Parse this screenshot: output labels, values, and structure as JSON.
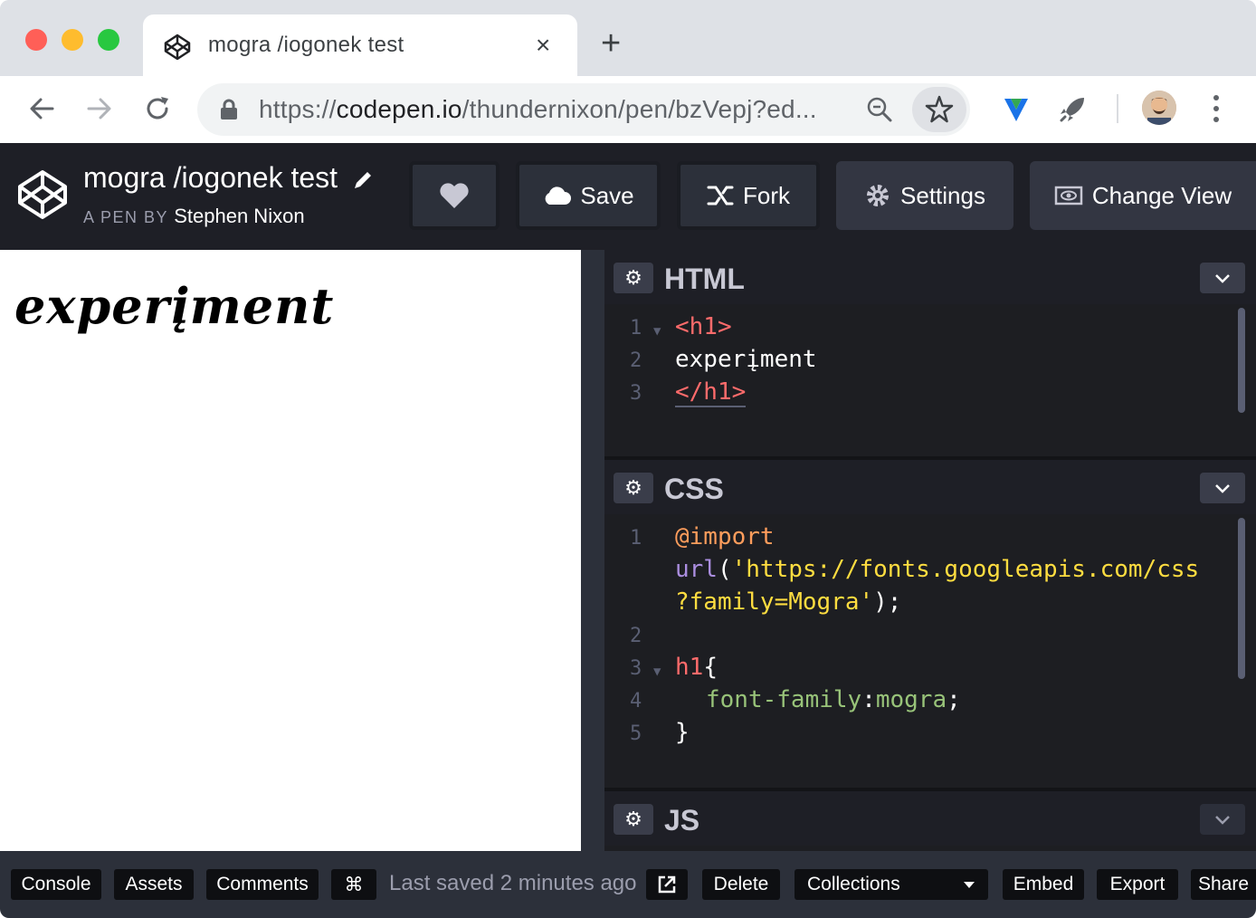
{
  "browser": {
    "tab_title": "mogra /iogonek test",
    "tab_close_icon": "×",
    "new_tab_icon": "+",
    "url_scheme": "https://",
    "url_host": "codepen.io",
    "url_path": "/thundernixon/pen/bzVepj?ed..."
  },
  "header": {
    "pen_title": "mogra /iogonek test",
    "by_label": "A PEN BY",
    "author": "Stephen Nixon",
    "buttons": {
      "save": "Save",
      "fork": "Fork",
      "settings": "Settings",
      "change_view": "Change View"
    }
  },
  "result": {
    "heading": "experįment"
  },
  "editors": {
    "html": {
      "name": "HTML",
      "lines": [
        {
          "n": "1",
          "text": "<h1>"
        },
        {
          "n": "2",
          "text": "experįment"
        },
        {
          "n": "3",
          "text": "</h1>"
        }
      ]
    },
    "css": {
      "name": "CSS",
      "line_numbers": [
        "1",
        "2",
        "3",
        "4",
        "5"
      ],
      "import": "@import",
      "url_fn": "url",
      "url_open": "(",
      "url_str_1": "'https://fonts.googleapis.com/css",
      "url_str_2": "?family=Mogra'",
      "url_close": ");",
      "selector": "h1",
      "brace_open": "{",
      "property": "font-family",
      "colon": ":",
      "value": "mogra",
      "semicolon": ";",
      "brace_close": "}"
    },
    "js": {
      "name": "JS"
    }
  },
  "footer": {
    "console": "Console",
    "assets": "Assets",
    "comments": "Comments",
    "shortcut": "⌘",
    "last_saved": "Last saved 2 minutes ago",
    "delete": "Delete",
    "collections": "Collections",
    "embed": "Embed",
    "export": "Export",
    "share": "Share"
  },
  "colors": {
    "header_bg": "#1e1f26",
    "editor_bg": "#1d1e22",
    "tag": "#ff6b6b",
    "string": "#ffdd40",
    "property": "#98c379",
    "at_rule": "#ff9d5c"
  }
}
